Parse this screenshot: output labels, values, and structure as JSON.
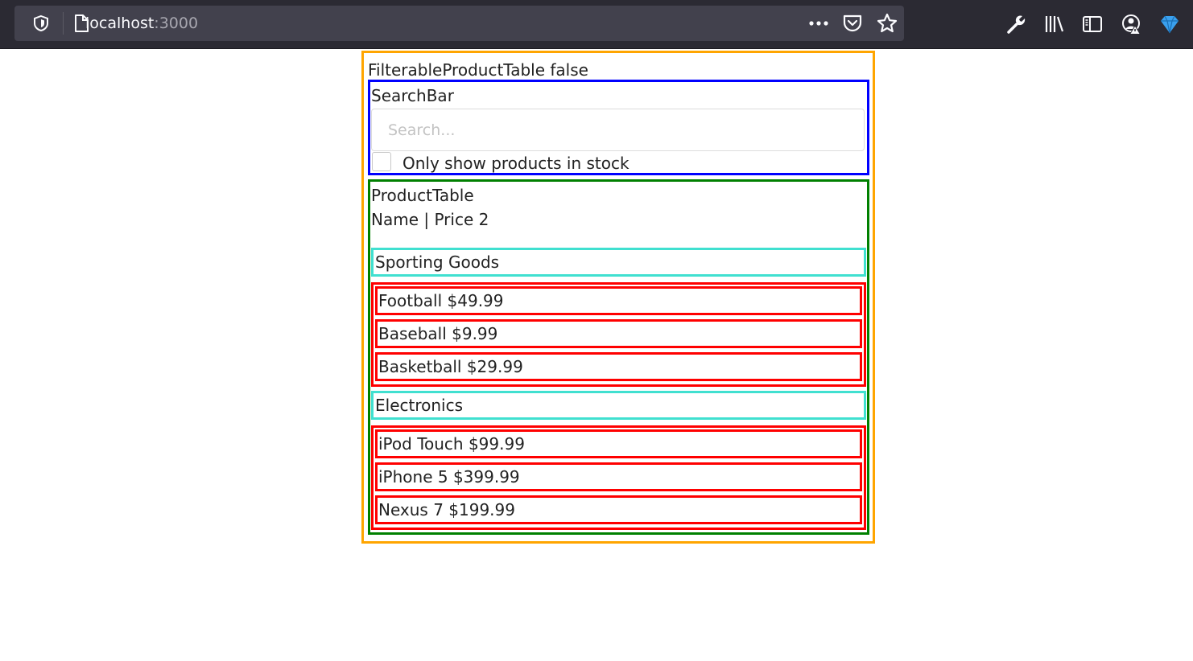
{
  "browser": {
    "url_host": "localhost",
    "url_port": ":3000",
    "icons": [
      "shield-icon",
      "page-icon",
      "more-icon",
      "pocket-icon",
      "bookmark-star-icon",
      "wrench-icon",
      "library-icon",
      "sidebar-icon",
      "account-icon",
      "extension-icon"
    ]
  },
  "app": {
    "title": "FilterableProductTable false",
    "search_bar": {
      "title": "SearchBar",
      "placeholder": "Search...",
      "value": "",
      "checkbox_label": "Only show products in stock",
      "checkbox_checked": false
    },
    "product_table": {
      "title": "ProductTable",
      "header": "Name | Price 2",
      "categories": [
        {
          "name": "Sporting Goods",
          "products": [
            "Football $49.99",
            "Baseball $9.99",
            "Basketball $29.99"
          ]
        },
        {
          "name": "Electronics",
          "products": [
            "iPod Touch $99.99",
            "iPhone 5 $399.99",
            "Nexus 7 $199.99"
          ]
        }
      ]
    }
  },
  "colors": {
    "filterable_border": "#ffa500",
    "searchbar_border": "#0000ff",
    "producttable_border": "#008000",
    "category_border": "#40e0d0",
    "product_border": "#ff0000"
  }
}
